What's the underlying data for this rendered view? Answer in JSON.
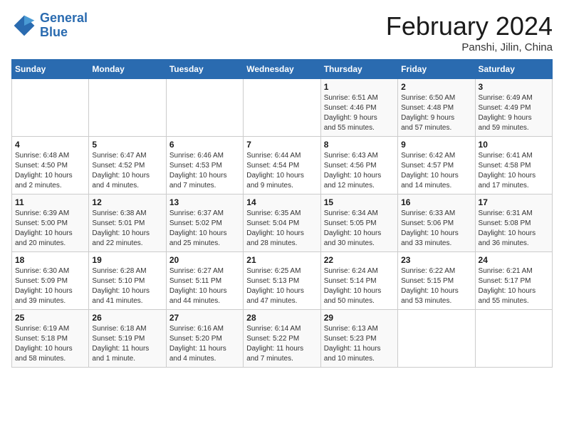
{
  "logo": {
    "line1": "General",
    "line2": "Blue"
  },
  "title": "February 2024",
  "location": "Panshi, Jilin, China",
  "days_header": [
    "Sunday",
    "Monday",
    "Tuesday",
    "Wednesday",
    "Thursday",
    "Friday",
    "Saturday"
  ],
  "weeks": [
    [
      {
        "day": "",
        "info": ""
      },
      {
        "day": "",
        "info": ""
      },
      {
        "day": "",
        "info": ""
      },
      {
        "day": "",
        "info": ""
      },
      {
        "day": "1",
        "info": "Sunrise: 6:51 AM\nSunset: 4:46 PM\nDaylight: 9 hours\nand 55 minutes."
      },
      {
        "day": "2",
        "info": "Sunrise: 6:50 AM\nSunset: 4:48 PM\nDaylight: 9 hours\nand 57 minutes."
      },
      {
        "day": "3",
        "info": "Sunrise: 6:49 AM\nSunset: 4:49 PM\nDaylight: 9 hours\nand 59 minutes."
      }
    ],
    [
      {
        "day": "4",
        "info": "Sunrise: 6:48 AM\nSunset: 4:50 PM\nDaylight: 10 hours\nand 2 minutes."
      },
      {
        "day": "5",
        "info": "Sunrise: 6:47 AM\nSunset: 4:52 PM\nDaylight: 10 hours\nand 4 minutes."
      },
      {
        "day": "6",
        "info": "Sunrise: 6:46 AM\nSunset: 4:53 PM\nDaylight: 10 hours\nand 7 minutes."
      },
      {
        "day": "7",
        "info": "Sunrise: 6:44 AM\nSunset: 4:54 PM\nDaylight: 10 hours\nand 9 minutes."
      },
      {
        "day": "8",
        "info": "Sunrise: 6:43 AM\nSunset: 4:56 PM\nDaylight: 10 hours\nand 12 minutes."
      },
      {
        "day": "9",
        "info": "Sunrise: 6:42 AM\nSunset: 4:57 PM\nDaylight: 10 hours\nand 14 minutes."
      },
      {
        "day": "10",
        "info": "Sunrise: 6:41 AM\nSunset: 4:58 PM\nDaylight: 10 hours\nand 17 minutes."
      }
    ],
    [
      {
        "day": "11",
        "info": "Sunrise: 6:39 AM\nSunset: 5:00 PM\nDaylight: 10 hours\nand 20 minutes."
      },
      {
        "day": "12",
        "info": "Sunrise: 6:38 AM\nSunset: 5:01 PM\nDaylight: 10 hours\nand 22 minutes."
      },
      {
        "day": "13",
        "info": "Sunrise: 6:37 AM\nSunset: 5:02 PM\nDaylight: 10 hours\nand 25 minutes."
      },
      {
        "day": "14",
        "info": "Sunrise: 6:35 AM\nSunset: 5:04 PM\nDaylight: 10 hours\nand 28 minutes."
      },
      {
        "day": "15",
        "info": "Sunrise: 6:34 AM\nSunset: 5:05 PM\nDaylight: 10 hours\nand 30 minutes."
      },
      {
        "day": "16",
        "info": "Sunrise: 6:33 AM\nSunset: 5:06 PM\nDaylight: 10 hours\nand 33 minutes."
      },
      {
        "day": "17",
        "info": "Sunrise: 6:31 AM\nSunset: 5:08 PM\nDaylight: 10 hours\nand 36 minutes."
      }
    ],
    [
      {
        "day": "18",
        "info": "Sunrise: 6:30 AM\nSunset: 5:09 PM\nDaylight: 10 hours\nand 39 minutes."
      },
      {
        "day": "19",
        "info": "Sunrise: 6:28 AM\nSunset: 5:10 PM\nDaylight: 10 hours\nand 41 minutes."
      },
      {
        "day": "20",
        "info": "Sunrise: 6:27 AM\nSunset: 5:11 PM\nDaylight: 10 hours\nand 44 minutes."
      },
      {
        "day": "21",
        "info": "Sunrise: 6:25 AM\nSunset: 5:13 PM\nDaylight: 10 hours\nand 47 minutes."
      },
      {
        "day": "22",
        "info": "Sunrise: 6:24 AM\nSunset: 5:14 PM\nDaylight: 10 hours\nand 50 minutes."
      },
      {
        "day": "23",
        "info": "Sunrise: 6:22 AM\nSunset: 5:15 PM\nDaylight: 10 hours\nand 53 minutes."
      },
      {
        "day": "24",
        "info": "Sunrise: 6:21 AM\nSunset: 5:17 PM\nDaylight: 10 hours\nand 55 minutes."
      }
    ],
    [
      {
        "day": "25",
        "info": "Sunrise: 6:19 AM\nSunset: 5:18 PM\nDaylight: 10 hours\nand 58 minutes."
      },
      {
        "day": "26",
        "info": "Sunrise: 6:18 AM\nSunset: 5:19 PM\nDaylight: 11 hours\nand 1 minute."
      },
      {
        "day": "27",
        "info": "Sunrise: 6:16 AM\nSunset: 5:20 PM\nDaylight: 11 hours\nand 4 minutes."
      },
      {
        "day": "28",
        "info": "Sunrise: 6:14 AM\nSunset: 5:22 PM\nDaylight: 11 hours\nand 7 minutes."
      },
      {
        "day": "29",
        "info": "Sunrise: 6:13 AM\nSunset: 5:23 PM\nDaylight: 11 hours\nand 10 minutes."
      },
      {
        "day": "",
        "info": ""
      },
      {
        "day": "",
        "info": ""
      }
    ]
  ]
}
